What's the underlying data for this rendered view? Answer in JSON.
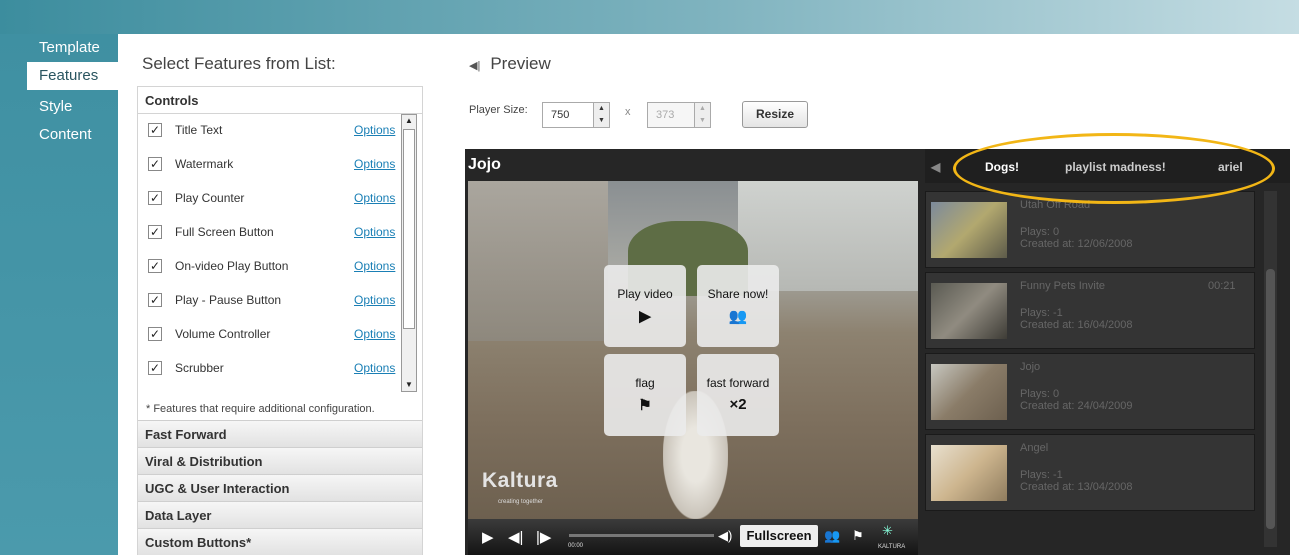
{
  "nav": {
    "items": [
      "Template",
      "Features",
      "Style",
      "Content"
    ],
    "active": "Features"
  },
  "features": {
    "heading": "Select Features from List:",
    "controls_section": "Controls",
    "items": [
      {
        "label": "Title Text",
        "checked": true,
        "options": "Options"
      },
      {
        "label": "Watermark",
        "checked": true,
        "options": "Options"
      },
      {
        "label": "Play Counter",
        "checked": true,
        "options": "Options"
      },
      {
        "label": "Full Screen Button",
        "checked": true,
        "options": "Options"
      },
      {
        "label": "On-video Play Button",
        "checked": true,
        "options": "Options"
      },
      {
        "label": "Play - Pause Button",
        "checked": true,
        "options": "Options"
      },
      {
        "label": "Volume Controller",
        "checked": true,
        "options": "Options"
      },
      {
        "label": "Scrubber",
        "checked": true,
        "options": "Options"
      }
    ],
    "check_mark": "✓",
    "footnote": "* Features that require additional configuration.",
    "sections": [
      "Fast Forward",
      "Viral & Distribution",
      "UGC & User Interaction",
      "Data Layer",
      "Custom Buttons*"
    ]
  },
  "preview": {
    "heading": "Preview",
    "size_label": "Player Size:",
    "width_value": "750",
    "height_value": "373",
    "x_label": "x",
    "resize_label": "Resize"
  },
  "player": {
    "title": "Jojo",
    "overlay_buttons": [
      {
        "label": "Play video",
        "icon": "▶"
      },
      {
        "label": "Share now!",
        "icon": "👥"
      },
      {
        "label": "flag",
        "icon": "⚑"
      },
      {
        "label": "fast forward",
        "icon": "×2"
      }
    ],
    "watermark": "Kaltura",
    "watermark_tagline": "creating together",
    "time": "00:00",
    "fullscreen_label": "Fullscreen",
    "brand": "KALTURA"
  },
  "playlist": {
    "tabs": [
      "Dogs!",
      "playlist madness!",
      "ariel"
    ],
    "items": [
      {
        "name": "Utah Off Road",
        "plays": "Plays: 0",
        "created": "Created at: 12/06/2008",
        "duration": ""
      },
      {
        "name": "Funny Pets Invite",
        "plays": "Plays: -1",
        "created": "Created at: 16/04/2008",
        "duration": "00:21"
      },
      {
        "name": "Jojo",
        "plays": "Plays: 0",
        "created": "Created at: 24/04/2009",
        "duration": ""
      },
      {
        "name": "Angel",
        "plays": "Plays: -1",
        "created": "Created at: 13/04/2008",
        "duration": ""
      }
    ]
  },
  "colors": {
    "accent": "#3f90a2",
    "highlight": "#f2b616",
    "link": "#1a7fb5"
  }
}
